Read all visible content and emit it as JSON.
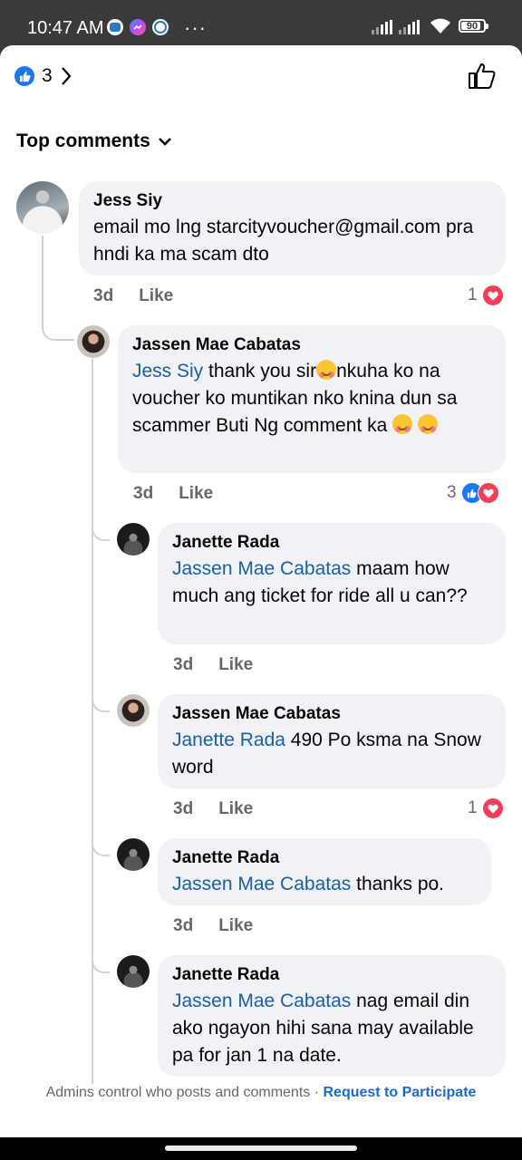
{
  "status_bar": {
    "time": "10:47 AM",
    "dots": "···",
    "battery": "90"
  },
  "header": {
    "reaction_count": "3"
  },
  "sort": {
    "label": "Top comments"
  },
  "comments": [
    {
      "author": "Jess Siy",
      "text": "email mo lng starcityvoucher@gmail.com pra hndi ka ma scam dto",
      "time": "3d",
      "like_label": "Like",
      "reaction_count": "1"
    },
    {
      "author": "Jassen Mae Cabatas",
      "mention": "Jess Siy",
      "text_a": " thank you sir",
      "text_b": "nkuha ko na voucher ko muntikan nko knina dun sa scammer Buti Ng comment ka ",
      "time": "3d",
      "like_label": "Like",
      "reaction_count": "3"
    },
    {
      "author": "Janette Rada",
      "mention": "Jassen Mae Cabatas",
      "text": " maam how much ang ticket for ride all u can??",
      "time": "3d",
      "like_label": "Like"
    },
    {
      "author": "Jassen Mae Cabatas",
      "mention": "Janette Rada",
      "text": " 490 Po ksma na Snow word",
      "time": "3d",
      "like_label": "Like",
      "reaction_count": "1"
    },
    {
      "author": "Janette Rada",
      "mention": "Jassen Mae Cabatas",
      "text": " thanks po.",
      "time": "3d",
      "like_label": "Like"
    },
    {
      "author": "Janette Rada",
      "mention": "Jassen Mae Cabatas",
      "text": " nag email din ako ngayon hihi sana may available pa for jan 1 na date."
    }
  ],
  "footer": {
    "notice": "Admins control who posts and comments · ",
    "link": "Request to Participate"
  },
  "colors": {
    "facebook_blue": "#1877f2",
    "mention_blue": "#1b5fa8",
    "love_red": "#f33e58",
    "bubble_bg": "#f0f2f5"
  }
}
